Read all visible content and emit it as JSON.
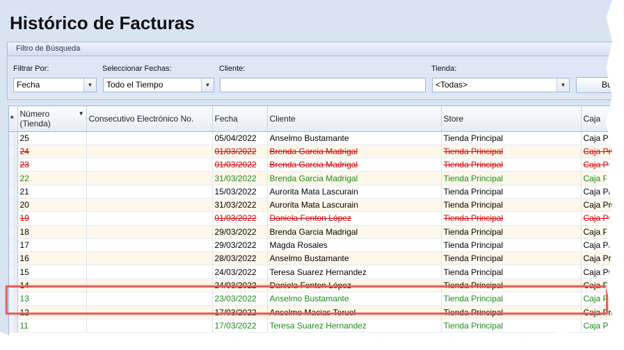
{
  "title": "Histórico de Facturas",
  "filter": {
    "group_title": "Filtro de Búsqueda",
    "filtrar_label": "Filtrar Por:",
    "filtrar_value": "Fecha",
    "fechas_label": "Seleccionar Fechas:",
    "fechas_value": "Todo el Tiempo",
    "cliente_label": "Cliente:",
    "cliente_value": "",
    "tienda_label": "Tienda:",
    "tienda_value": "<Todas>",
    "search_button_partial": "Bu"
  },
  "grid": {
    "indicator_header": "*",
    "columns": [
      "Número (Tienda)",
      "Consecutivo Electrónico No.",
      "Fecha",
      "Cliente",
      "Store",
      "Caja"
    ],
    "rows": [
      {
        "num": "25",
        "consec": "",
        "fecha": "05/04/2022",
        "cliente": "Anselmo Bustamante",
        "store": "Tienda Principal",
        "caja": "Caja P",
        "status": "normal"
      },
      {
        "num": "24",
        "consec": "",
        "fecha": "01/03/2022",
        "cliente": "Brenda Garcia Madrigal",
        "store": "Tienda Principal",
        "caja": "Caja Pri",
        "status": "cancel"
      },
      {
        "num": "23",
        "consec": "",
        "fecha": "01/03/2022",
        "cliente": "Brenda Garcia Madrigal",
        "store": "Tienda Principal",
        "caja": "Caja Pri",
        "status": "cancel"
      },
      {
        "num": "22",
        "consec": "",
        "fecha": "31/03/2022",
        "cliente": "Brenda Garcia Madrigal",
        "store": "Tienda Principal",
        "caja": "Caja Prin",
        "status": "green"
      },
      {
        "num": "21",
        "consec": "",
        "fecha": "15/03/2022",
        "cliente": "Aurorita Mata Lascurain",
        "store": "Tienda Principal",
        "caja": "Caja Pri",
        "status": "normal"
      },
      {
        "num": "20",
        "consec": "",
        "fecha": "31/03/2022",
        "cliente": "Aurorita Mata Lascurain",
        "store": "Tienda Principal",
        "caja": "Caja Pri",
        "status": "normal"
      },
      {
        "num": "19",
        "consec": "",
        "fecha": "01/03/2022",
        "cliente": "Daniela Fenton López",
        "store": "Tienda Principal",
        "caja": "Caja Pri",
        "status": "cancel"
      },
      {
        "num": "18",
        "consec": "",
        "fecha": "29/03/2022",
        "cliente": "Brenda Garcia Madrigal",
        "store": "Tienda Principal",
        "caja": "Caja Pri",
        "status": "normal"
      },
      {
        "num": "17",
        "consec": "",
        "fecha": "29/03/2022",
        "cliente": "Magda Rosales",
        "store": "Tienda Principal",
        "caja": "Caja Pri",
        "status": "normal"
      },
      {
        "num": "16",
        "consec": "",
        "fecha": "28/03/2022",
        "cliente": "Anselmo Bustamante",
        "store": "Tienda Principal",
        "caja": "Caja Pr",
        "status": "normal"
      },
      {
        "num": "15",
        "consec": "",
        "fecha": "24/03/2022",
        "cliente": "Teresa Suarez Hernandez",
        "store": "Tienda Principal",
        "caja": "Caja Pri",
        "status": "normal"
      },
      {
        "num": "14",
        "consec": "",
        "fecha": "24/03/2022",
        "cliente": "Daniela Fenton López",
        "store": "Tienda Principal",
        "caja": "Caja Pri",
        "status": "normal"
      },
      {
        "num": "13",
        "consec": "",
        "fecha": "23/03/2022",
        "cliente": "Anselmo Bustamante",
        "store": "Tienda Principal",
        "caja": "Caja Pri",
        "status": "green"
      },
      {
        "num": "12",
        "consec": "",
        "fecha": "17/03/2022",
        "cliente": "Anselmo Macias Teruel",
        "store": "Tienda Principal",
        "caja": "Caja Pri",
        "status": "normal"
      },
      {
        "num": "11",
        "consec": "",
        "fecha": "17/03/2022",
        "cliente": "Teresa Suarez Hernandez",
        "store": "Tienda Principal",
        "caja": "Caja Pri",
        "status": "green"
      }
    ]
  },
  "colors": {
    "cancelled_text": "#d40000",
    "green_text": "#1c8a1c",
    "highlight_border": "#e6605a",
    "window_bg": "#d9e4f3"
  }
}
